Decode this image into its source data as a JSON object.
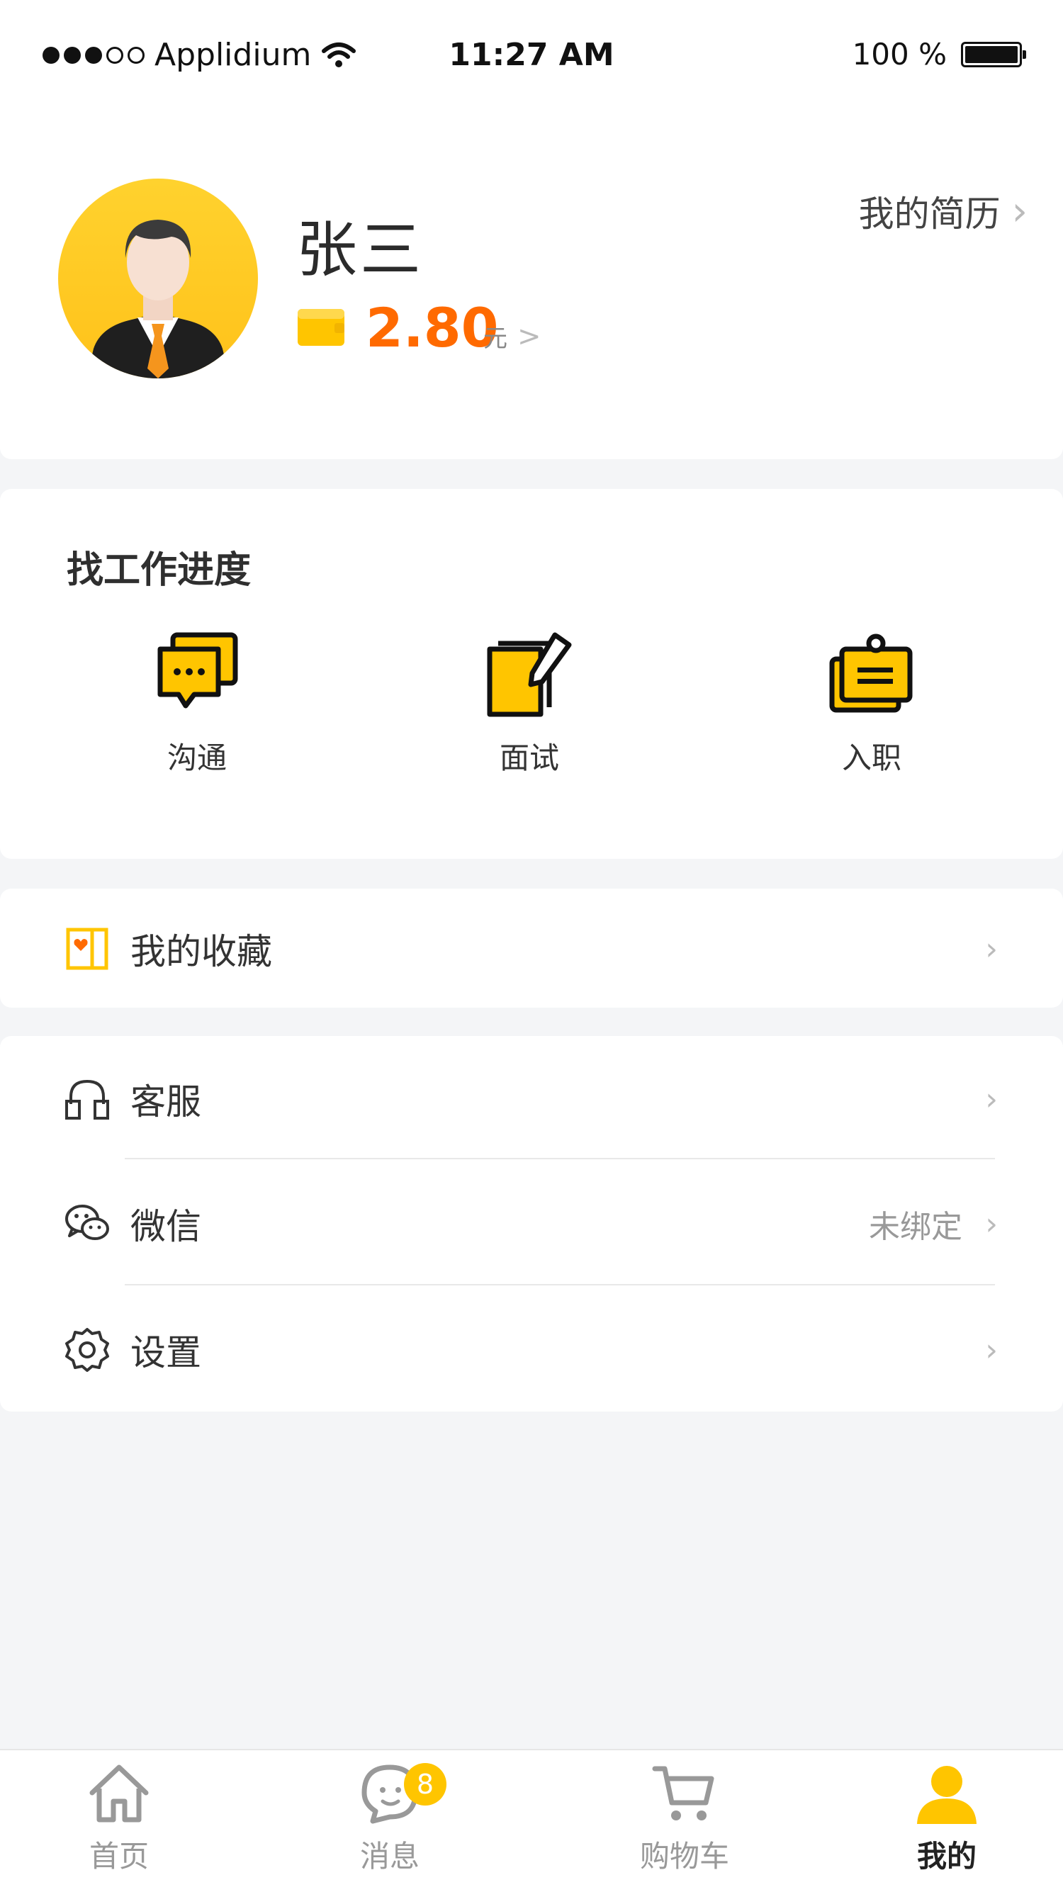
{
  "status_bar": {
    "carrier": "Applidium",
    "time": "11:27 AM",
    "battery": "100 %"
  },
  "profile": {
    "name": "张三",
    "balance": "2.80",
    "currency": "元",
    "resume_link": "我的简历"
  },
  "progress": {
    "title": "找工作进度",
    "items": [
      {
        "label": "沟通",
        "icon": "chat-bubbles-icon"
      },
      {
        "label": "面试",
        "icon": "edit-document-icon"
      },
      {
        "label": "入职",
        "icon": "clipboard-badge-icon"
      }
    ]
  },
  "menu": {
    "favorites": {
      "label": "我的收藏",
      "icon": "bookmark-heart-icon"
    },
    "service": {
      "label": "客服",
      "icon": "headset-icon"
    },
    "wechat": {
      "label": "微信",
      "icon": "wechat-icon",
      "status": "未绑定"
    },
    "settings": {
      "label": "设置",
      "icon": "gear-icon"
    }
  },
  "tabs": {
    "items": [
      {
        "label": "首页",
        "icon": "home-icon"
      },
      {
        "label": "消息",
        "icon": "message-icon",
        "badge": "8"
      },
      {
        "label": "购物车",
        "icon": "cart-icon"
      },
      {
        "label": "我的",
        "icon": "user-icon",
        "active": true
      }
    ]
  },
  "colors": {
    "accent": "#ffc500",
    "balance": "#ff6a00",
    "background": "#f4f5f7"
  }
}
